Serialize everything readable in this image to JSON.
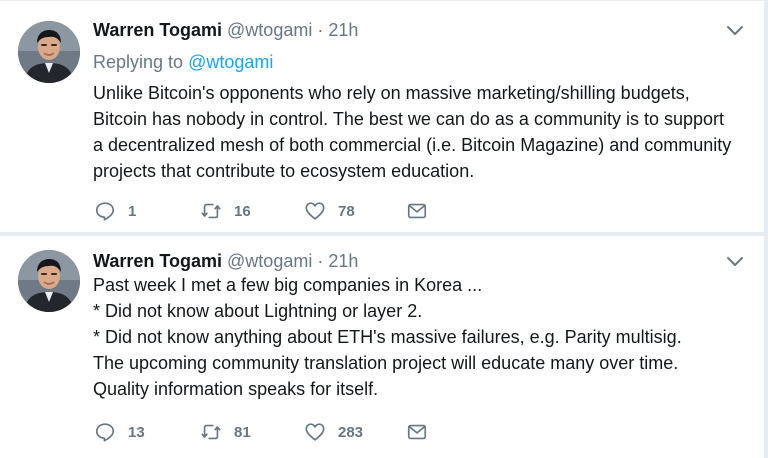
{
  "tweets": [
    {
      "name": "Warren Togami",
      "handle": "@wtogami",
      "dot": "·",
      "time": "21h",
      "replying_prefix": "Replying to ",
      "replying_to": "@wtogami",
      "lines": [
        "Unlike Bitcoin's opponents who rely on massive marketing/shilling budgets,",
        "Bitcoin has nobody in control. The best we can do as a community is to support",
        "a decentralized mesh of both commercial (i.e. Bitcoin Magazine) and community",
        "projects that contribute to ecosystem education."
      ],
      "replies": "1",
      "retweets": "16",
      "likes": "78"
    },
    {
      "name": "Warren Togami",
      "handle": "@wtogami",
      "dot": "·",
      "time": "21h",
      "lines": [
        "Past week I met a few big companies in Korea ...",
        "* Did not know about Lightning or layer 2.",
        "* Did not know anything about ETH's massive failures, e.g. Parity multisig.",
        "The upcoming community translation project will educate many over time.",
        "Quality information speaks for itself."
      ],
      "replies": "13",
      "retweets": "81",
      "likes": "283"
    }
  ],
  "icons": {
    "reply": "reply-icon",
    "retweet": "retweet-icon",
    "like": "heart-icon",
    "dm": "envelope-icon",
    "more": "chevron-down-icon"
  },
  "colors": {
    "link": "#1da1f2",
    "muted": "#657786",
    "text": "#14171a",
    "divider": "#e6ecf0"
  }
}
